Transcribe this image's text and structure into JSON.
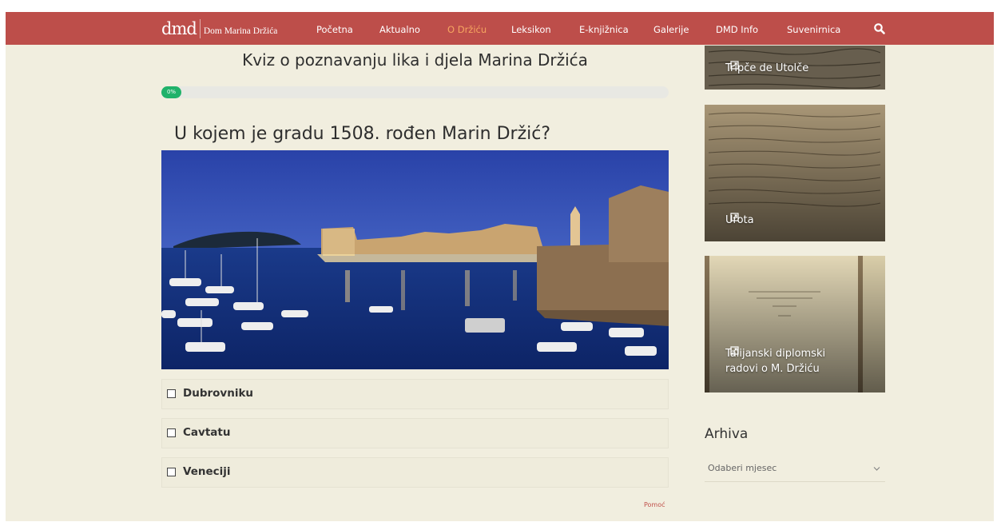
{
  "header": {
    "logo_mark": "dmd",
    "logo_name": "Dom Marina Držića",
    "nav": [
      {
        "label": "Početna"
      },
      {
        "label": "Aktualno"
      },
      {
        "label": "O Držiću",
        "active": true
      },
      {
        "label": "Leksikon"
      },
      {
        "label": "E-knjižnica"
      },
      {
        "label": "Galerije"
      },
      {
        "label": "DMD Info"
      },
      {
        "label": "Suvenirnica"
      }
    ],
    "search_icon": "search-icon"
  },
  "quiz": {
    "title": "Kviz o poznavanju lika i djela Marina Držića",
    "progress_label": "0%",
    "progress": 0,
    "question": "U kojem je gradu 1508. rođen Marin Držić?",
    "options": [
      {
        "label": "Dubrovniku"
      },
      {
        "label": "Cavtatu"
      },
      {
        "label": "Veneciji"
      }
    ],
    "help_label": "Pomoć"
  },
  "sidebar": {
    "cards": [
      {
        "label": "Tripče de Utolče"
      },
      {
        "label": "Urota"
      },
      {
        "label_lines": [
          "Talijanski diplomski",
          "radovi o M. Držiću"
        ]
      }
    ],
    "archive": {
      "title": "Arhiva",
      "select_value": "Odaberi mjesec"
    }
  },
  "colors": {
    "header_bg": "#bd4e4a",
    "page_bg": "#f1eedf",
    "active_nav": "#f6a560",
    "progress": "#20b26a",
    "link": "#c0504a"
  }
}
